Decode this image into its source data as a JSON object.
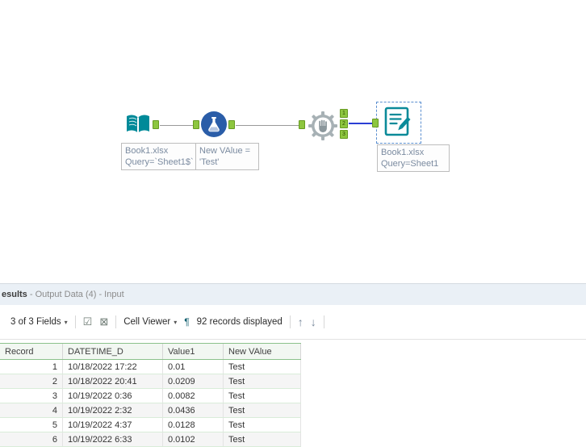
{
  "canvas": {
    "tools": [
      {
        "id": "input-data",
        "annotation": [
          "Book1.xlsx",
          "Query=`Sheet1$`"
        ]
      },
      {
        "id": "formula",
        "annotation": [
          "New VAlue =",
          "'Test'"
        ]
      },
      {
        "id": "block-until-done",
        "outputs": [
          "1",
          "2",
          "3"
        ]
      },
      {
        "id": "output-data",
        "annotation": [
          "Book1.xlsx",
          "Query=Sheet1"
        ]
      }
    ]
  },
  "results": {
    "header": {
      "bold": "esults",
      "rest": " - Output Data (4) - Input"
    },
    "toolbar": {
      "fields": "3 of 3 Fields",
      "caret": "▾",
      "check_icon": "☑",
      "uncheck_icon": "⊠",
      "cell_viewer": "Cell Viewer",
      "pilcrow": "¶",
      "records": "92 records displayed",
      "up": "↑",
      "down": "↓"
    },
    "table": {
      "columns": [
        "Record",
        "DATETIME_D",
        "Value1",
        "New VAlue"
      ],
      "rows": [
        [
          "1",
          "10/18/2022 17:22",
          "0.01",
          "Test"
        ],
        [
          "2",
          "10/18/2022 20:41",
          "0.0209",
          "Test"
        ],
        [
          "3",
          "10/19/2022 0:36",
          "0.0082",
          "Test"
        ],
        [
          "4",
          "10/19/2022 2:32",
          "0.0436",
          "Test"
        ],
        [
          "5",
          "10/19/2022 4:37",
          "0.0128",
          "Test"
        ],
        [
          "6",
          "10/19/2022 6:33",
          "0.0102",
          "Test"
        ]
      ]
    }
  },
  "colors": {
    "alteryx_teal": "#008a99",
    "formula_blue": "#2a5da8",
    "anchor_green": "#8dc63f",
    "selected_wire_blue": "#2b3fd4",
    "table_grid_green": "#8cc28c"
  }
}
